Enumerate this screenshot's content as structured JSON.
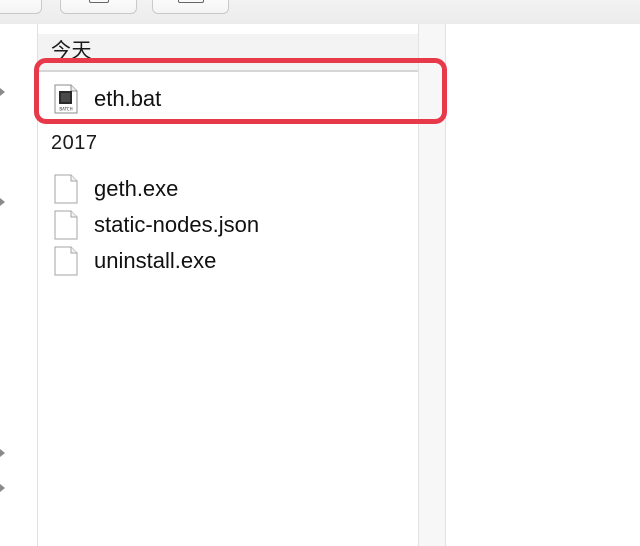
{
  "toolbar": {
    "buttons": [
      "back-forward",
      "share",
      "tags"
    ]
  },
  "file_list": {
    "sections": [
      {
        "header": "今天",
        "files": [
          {
            "name": "eth.bat",
            "icon": "batch-file-icon"
          }
        ]
      },
      {
        "header": "2017",
        "files": [
          {
            "name": "geth.exe",
            "icon": "document-icon"
          },
          {
            "name": "static-nodes.json",
            "icon": "document-icon"
          },
          {
            "name": "uninstall.exe",
            "icon": "document-icon"
          }
        ]
      }
    ]
  },
  "batch_icon_label": "BATCH",
  "colors": {
    "highlight": "#e8394a",
    "header_bg": "#f3f3f3",
    "text": "#111111"
  }
}
